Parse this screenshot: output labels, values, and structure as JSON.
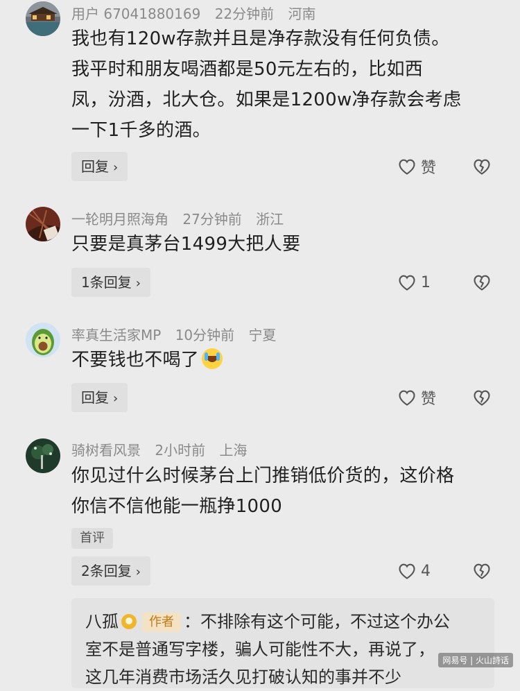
{
  "comments": [
    {
      "user": "用户 67041880169",
      "time": "22分钟前",
      "location": "河南",
      "text_lines": [
        "我也有120w存款并且是净存款没有任何负债。",
        "我平时和朋友喝酒都是50元左右的，比如西",
        "凤，汾酒，北大仓。如果是1200w净存款会考虑",
        "一下1千多的酒。"
      ],
      "reply_label": "回复",
      "like_label": "赞",
      "avatar_icon": "landscape-avatar"
    },
    {
      "user": "一轮明月照海角",
      "time": "27分钟前",
      "location": "浙江",
      "text_lines": [
        "只要是真茅台1499大把人要"
      ],
      "reply_label": "1条回复",
      "like_label": "1",
      "avatar_icon": "dried-leaves-avatar"
    },
    {
      "user": "率真生活家MP",
      "time": "10分钟前",
      "location": "宁夏",
      "text_lines": [
        "不要钱也不喝了"
      ],
      "reply_label": "回复",
      "like_label": "赞",
      "avatar_icon": "avocado-avatar"
    },
    {
      "user": "骑树看风景",
      "time": "2小时前",
      "location": "上海",
      "text_lines": [
        "你见过什么时候茅台上门推销低价货的，这价格",
        "你信不信他能一瓶挣1000"
      ],
      "tag": "首评",
      "reply_label": "2条回复",
      "like_label": "4",
      "avatar_icon": "tree-avatar"
    }
  ],
  "sub_reply": {
    "user": "八孤",
    "badge": "作者",
    "text_lines": [
      "：不排除有这个可能，不过这个办公",
      "室不是普通写字楼，骗人可能性不大，再说了，",
      "这几年消费市场活久见打破认知的事并不少"
    ]
  },
  "watermark": "网易号 | 火山詩话",
  "colors": {
    "background": "#ebebeb",
    "meta": "#8a8a8a",
    "badge_bg": "#f3e2c4",
    "badge_text": "#c07b19"
  }
}
